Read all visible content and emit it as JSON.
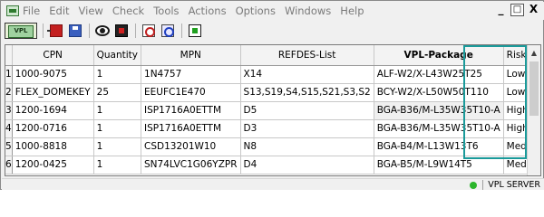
{
  "menu": [
    "File",
    "Edit",
    "View",
    "Check",
    "Tools",
    "Actions",
    "Options",
    "Windows",
    "Help"
  ],
  "window_controls": [
    "_",
    "□",
    "X"
  ],
  "toolbar": {
    "vpl_label": "VPL",
    "icons": [
      "import-icon",
      "save-icon",
      "view-icon",
      "chip-icon",
      "find-icon",
      "find-next-icon",
      "component-icon"
    ]
  },
  "table": {
    "columns": [
      "CPN",
      "Quantity",
      "MPN",
      "REFDES-List",
      "VPL-Package",
      "Risk-Rating"
    ],
    "rows": [
      {
        "num": "1",
        "cpn": "1000-9075",
        "qty": "1",
        "mpn": "1N4757",
        "refdes": "X14",
        "package": "ALF-W2/X-L43W25T25",
        "risk": "Low"
      },
      {
        "num": "2",
        "cpn": "FLEX_DOMEKEY",
        "qty": "25",
        "mpn": "EEUFC1E470",
        "refdes": "S13,S19,S4,S15,S21,S3,S2",
        "package": "BCY-W2/X-L50W50T110",
        "risk": "Low"
      },
      {
        "num": "3",
        "cpn": "1200-1694",
        "qty": "1",
        "mpn": "ISP1716A0ETTM",
        "refdes": "D5",
        "package": "BGA-B36/M-L35W35T10-A",
        "risk": "High"
      },
      {
        "num": "4",
        "cpn": "1200-0716",
        "qty": "1",
        "mpn": "ISP1716A0ETTM",
        "refdes": "D3",
        "package": "BGA-B36/M-L35W35T10-A",
        "risk": "High"
      },
      {
        "num": "5",
        "cpn": "1000-8818",
        "qty": "1",
        "mpn": "CSD13201W10",
        "refdes": "N8",
        "package": "BGA-B4/M-L13W13T6",
        "risk": "Medium"
      },
      {
        "num": "6",
        "cpn": "1200-0425",
        "qty": "1",
        "mpn": "SN74LVC1G06YZPR",
        "refdes": "D4",
        "package": "BGA-B5/M-L9W14T5",
        "risk": "Medium"
      }
    ]
  },
  "status": {
    "server": "VPL SERVER"
  },
  "colors": {
    "highlight": "#1a9a9a",
    "status_ok": "#2bb52b"
  }
}
